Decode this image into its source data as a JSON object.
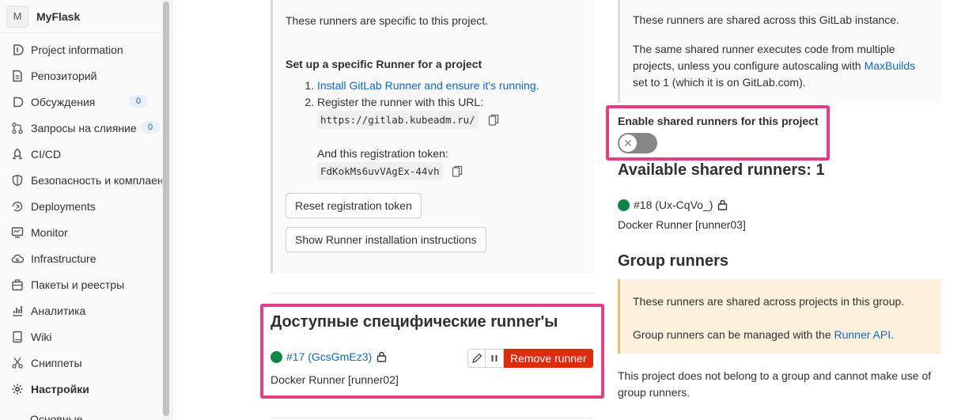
{
  "sidebar": {
    "avatar_letter": "M",
    "project_name": "MyFlask",
    "items": [
      {
        "label": "Project information",
        "icon": "info-icon"
      },
      {
        "label": "Репозиторий",
        "icon": "doc-icon"
      },
      {
        "label": "Обсуждения",
        "icon": "issues-icon",
        "count": "0"
      },
      {
        "label": "Запросы на слияние",
        "icon": "merge-request-icon",
        "count": "0"
      },
      {
        "label": "CI/CD",
        "icon": "rocket-icon"
      },
      {
        "label": "Безопасность и комплаенс",
        "icon": "shield-icon"
      },
      {
        "label": "Deployments",
        "icon": "deployments-icon"
      },
      {
        "label": "Monitor",
        "icon": "monitor-icon"
      },
      {
        "label": "Infrastructure",
        "icon": "cloud-icon"
      },
      {
        "label": "Пакеты и реестры",
        "icon": "package-icon"
      },
      {
        "label": "Аналитика",
        "icon": "chart-icon"
      },
      {
        "label": "Wiki",
        "icon": "book-icon"
      },
      {
        "label": "Сниппеты",
        "icon": "scissors-icon"
      },
      {
        "label": "Настройки",
        "icon": "gear-icon",
        "active": true
      }
    ],
    "sub_item": "Основные"
  },
  "specific": {
    "intro": "These runners are specific to this project.",
    "setup_title": "Set up a specific Runner for a project",
    "step1_link": "Install GitLab Runner and ensure it's running.",
    "step2_text": "Register the runner with this URL:",
    "url": "https://gitlab.kubeadm.ru/",
    "token_text": "And this registration token:",
    "token": "FdKokMs6uvVAgEx-44vh",
    "reset_button": "Reset registration token",
    "show_instructions_button": "Show Runner installation instructions",
    "available_title": "Доступные специфические runner'ы",
    "runner_link": "#17 (GcsGmEz3)",
    "runner_desc": "Docker Runner [runner02]",
    "remove_button": "Remove runner"
  },
  "shared": {
    "intro": "These runners are shared across this GitLab instance.",
    "desc_before": "The same shared runner executes code from multiple projects, unless you configure autoscaling with ",
    "desc_link": "MaxBuilds",
    "desc_after": " set to 1 (which it is on GitLab.com).",
    "toggle_label": "Enable shared runners for this project",
    "toggle_on": false,
    "available_title": "Available shared runners: 1",
    "runner_label": "#18 (Ux-CqVo_)",
    "runner_desc": "Docker Runner [runner03]"
  },
  "group": {
    "title": "Group runners",
    "notice1": "These runners are shared across projects in this group.",
    "notice2_before": "Group runners can be managed with the ",
    "notice2_link": "Runner API",
    "notice2_after": ".",
    "no_group_text": "This project does not belong to a group and cannot make use of group runners."
  },
  "colors": {
    "highlight": "#e43f86",
    "link": "#1068bf",
    "danger": "#dd2b0e",
    "status_online": "#108548"
  }
}
